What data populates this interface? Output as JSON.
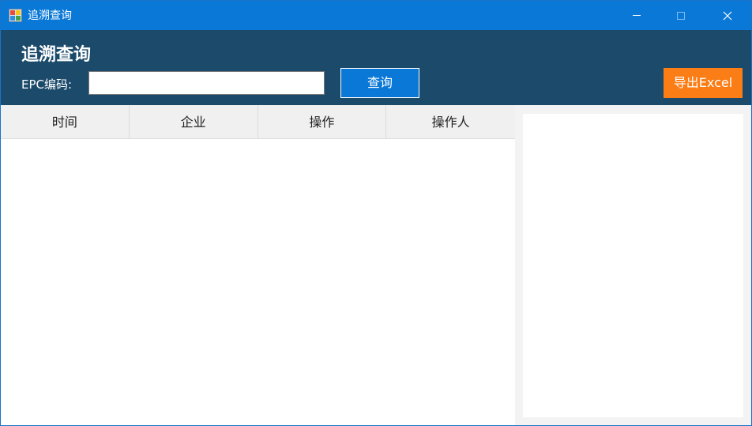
{
  "window": {
    "title": "追溯查询",
    "accent": "#0a78d7"
  },
  "header": {
    "title": "追溯查询",
    "epc_label": "EPC编码:",
    "epc_value": "",
    "query_label": "查询",
    "export_label": "导出Excel",
    "bg": "#1b4a6b",
    "export_color": "#fb7d16"
  },
  "grid": {
    "columns": [
      "时间",
      "企业",
      "操作",
      "操作人"
    ],
    "rows": []
  },
  "icons": {
    "app": "app-icon",
    "minimize": "minimize-icon",
    "maximize": "maximize-icon",
    "close": "close-icon"
  }
}
